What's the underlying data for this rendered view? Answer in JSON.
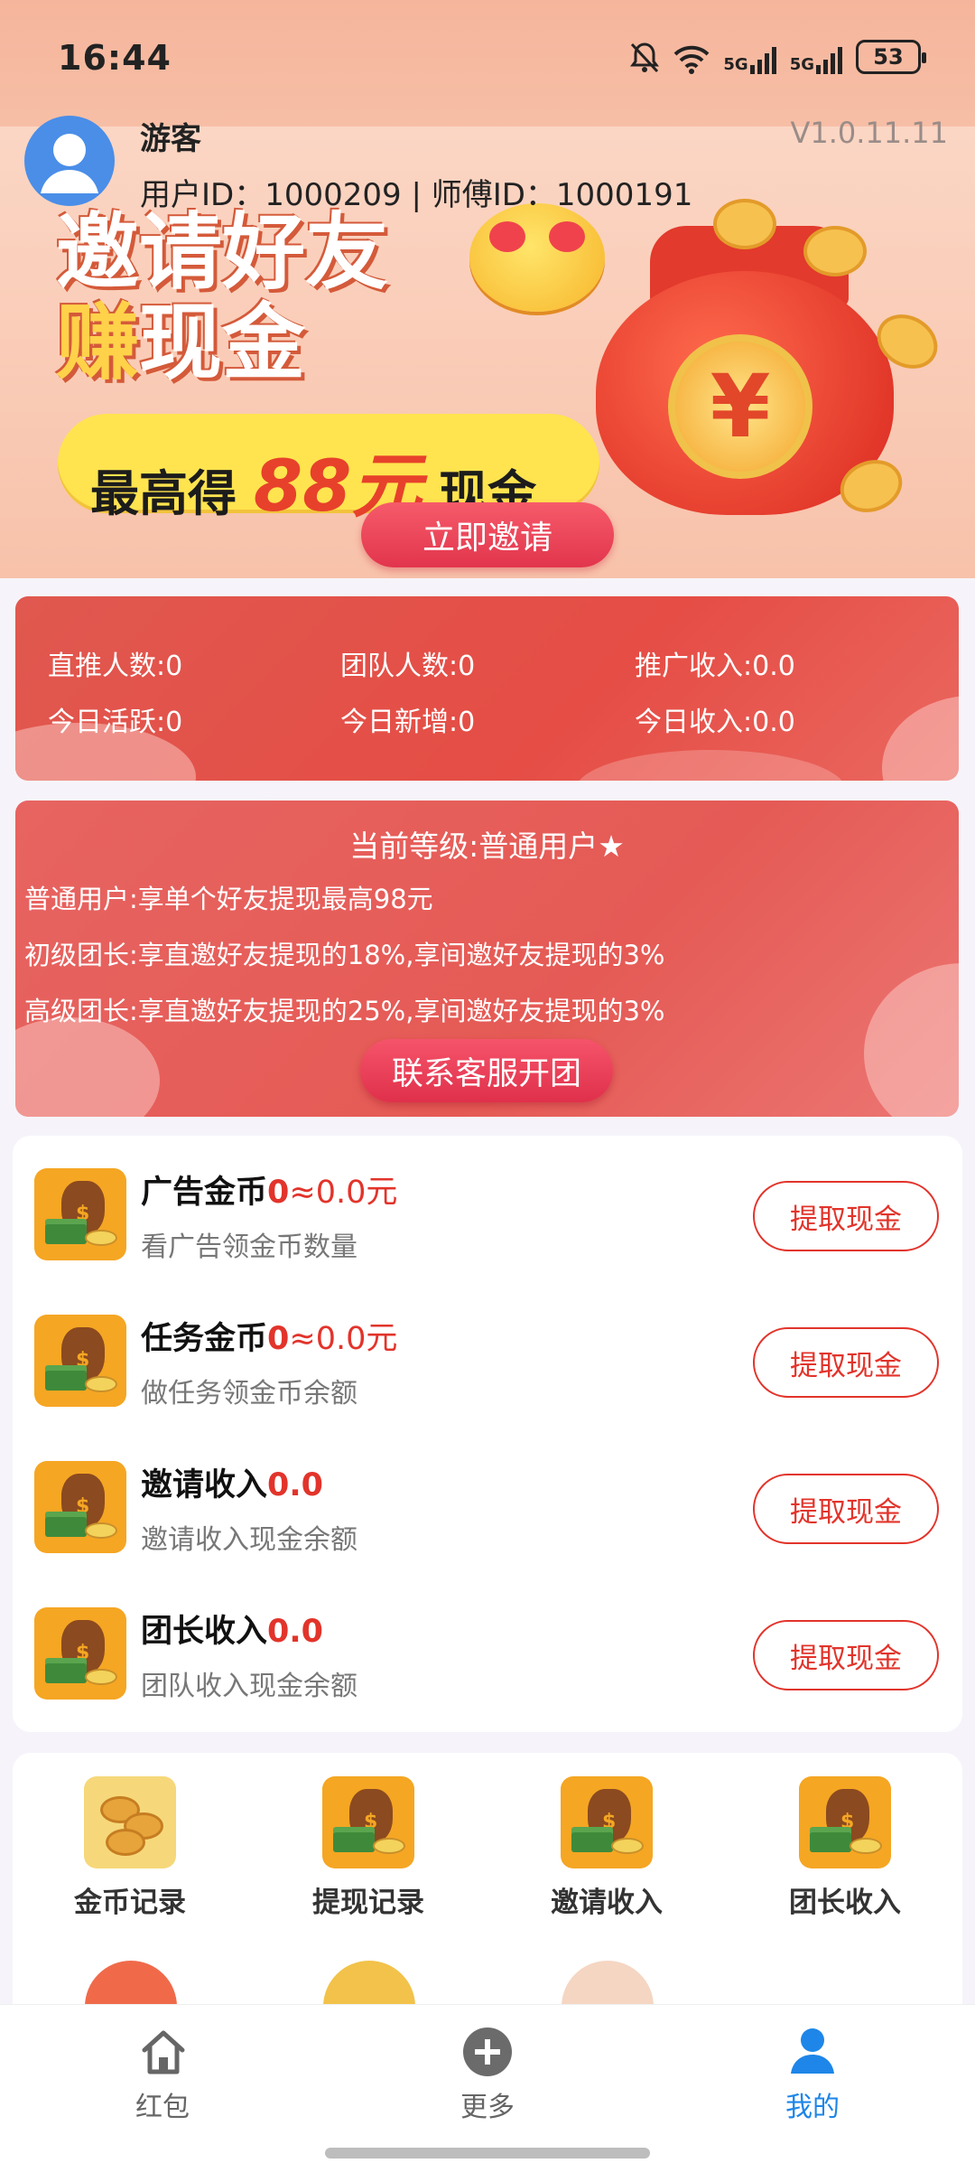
{
  "status_bar": {
    "time": "16:44",
    "battery": "53",
    "network1": "5G",
    "network2": "5G"
  },
  "user": {
    "name": "游客",
    "ids": "用户ID：1000209 | 师傅ID：1000191",
    "version": "V1.0.11.11"
  },
  "banner": {
    "title_line1": "邀请好友",
    "title_line2_gold": "赚",
    "title_line2": "现金",
    "pill_prefix": "最高得",
    "pill_amount": "88元",
    "pill_suffix": "现金",
    "coin_symbol": "¥",
    "invite_button": "立即邀请"
  },
  "stats": {
    "direct": "直推人数:0",
    "team": "团队人数:0",
    "promo_income": "推广收入:0.0",
    "today_active": "今日活跃:0",
    "today_new": "今日新增:0",
    "today_income": "今日收入:0.0"
  },
  "level": {
    "title": "当前等级:普通用户★",
    "line1": "普通用户:享单个好友提现最高98元",
    "line2": "初级团长:享直邀好友提现的18%,享间邀好友提现的3%",
    "line3": "高级团长:享直邀好友提现的25%,享间邀好友提现的3%",
    "contact_button": "联系客服开团"
  },
  "wallet": [
    {
      "title": "广告金币",
      "amount": "0",
      "conversion": "≈0.0元",
      "subtitle": "看广告领金币数量",
      "button": "提取现金"
    },
    {
      "title": "任务金币",
      "amount": "0",
      "conversion": "≈0.0元",
      "subtitle": "做任务领金币余额",
      "button": "提取现金"
    },
    {
      "title": "邀请收入",
      "amount": "0.0",
      "conversion": "",
      "subtitle": "邀请收入现金余额",
      "button": "提取现金"
    },
    {
      "title": "团长收入",
      "amount": "0.0",
      "conversion": "",
      "subtitle": "团队收入现金余额",
      "button": "提取现金"
    }
  ],
  "grid": [
    {
      "label": "金币记录",
      "icon": "coins-icon"
    },
    {
      "label": "提现记录",
      "icon": "money-bag-icon"
    },
    {
      "label": "邀请收入",
      "icon": "money-bag-icon"
    },
    {
      "label": "团长收入",
      "icon": "money-bag-icon"
    }
  ],
  "bottom_nav": [
    {
      "label": "红包",
      "icon": "home-icon",
      "active": false
    },
    {
      "label": "更多",
      "icon": "plus-circle-icon",
      "active": false
    },
    {
      "label": "我的",
      "icon": "person-icon",
      "active": true
    }
  ],
  "colors": {
    "accent_red": "#e2342b",
    "nav_active": "#1e86e8",
    "card_red": "#e55a55",
    "coin_orange": "#f5a623"
  }
}
